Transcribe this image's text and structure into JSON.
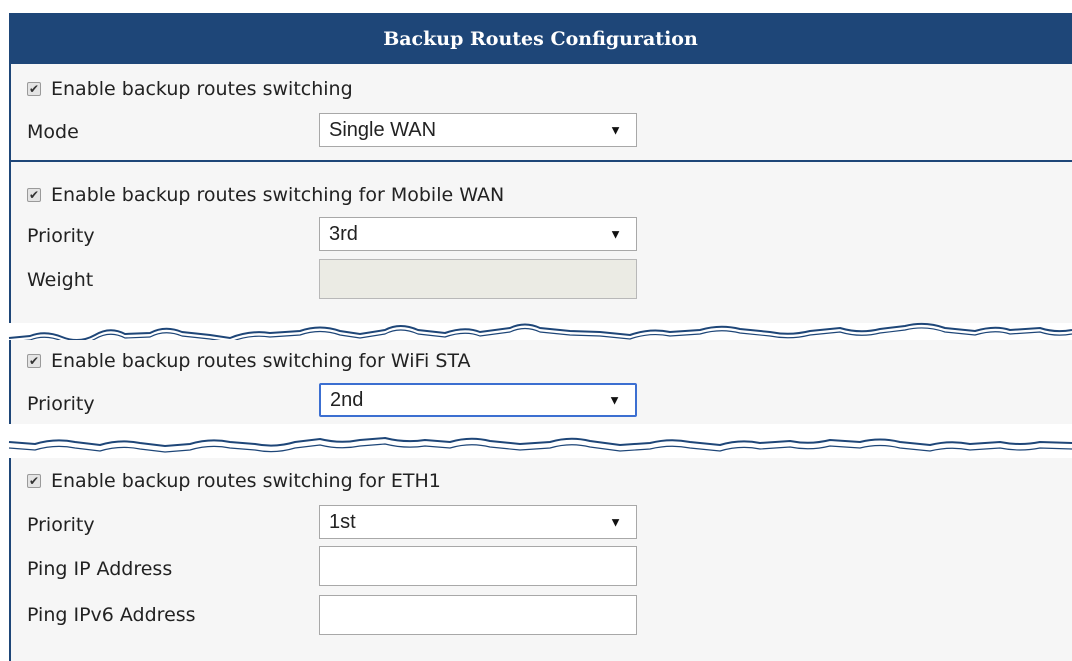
{
  "header": {
    "title": "Backup Routes Configuration"
  },
  "general": {
    "enable_label": "Enable backup routes switching",
    "enable_checked": true,
    "mode_label": "Mode",
    "mode_value": "Single WAN"
  },
  "mobile_wan": {
    "enable_label": "Enable backup routes switching for Mobile WAN",
    "enable_checked": true,
    "priority_label": "Priority",
    "priority_value": "3rd",
    "weight_label": "Weight",
    "weight_value": ""
  },
  "wifi_sta": {
    "enable_label": "Enable backup routes switching for WiFi STA",
    "enable_checked": true,
    "priority_label": "Priority",
    "priority_value": "2nd"
  },
  "eth1": {
    "enable_label": "Enable backup routes switching for ETH1",
    "enable_checked": true,
    "priority_label": "Priority",
    "priority_value": "1st",
    "ping_ip_label": "Ping IP Address",
    "ping_ip_value": "",
    "ping_ipv6_label": "Ping IPv6 Address",
    "ping_ipv6_value": ""
  },
  "icons": {
    "checkbox": "check-icon",
    "dropdown": "triangle-down-icon"
  }
}
